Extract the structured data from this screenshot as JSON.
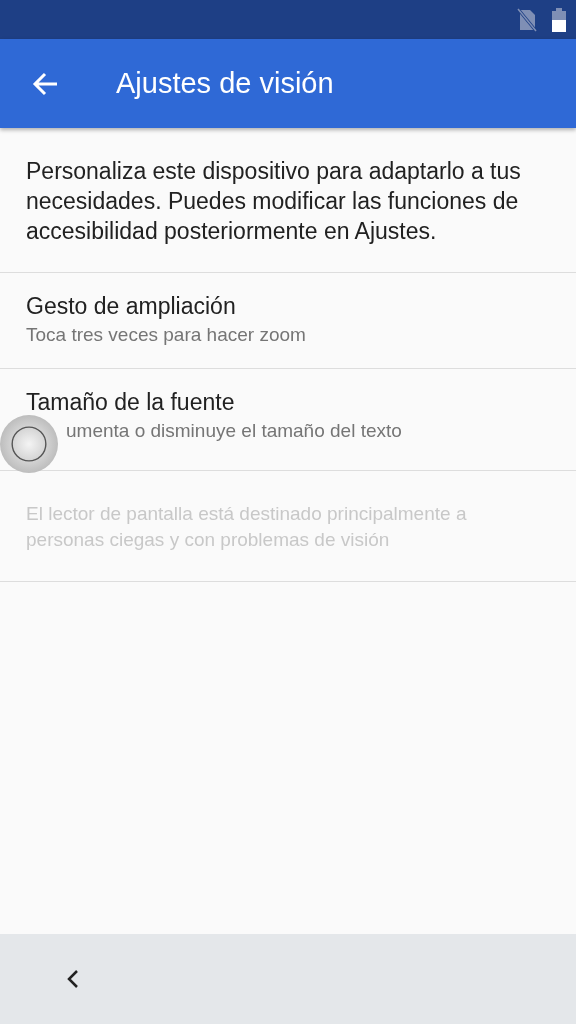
{
  "app_bar": {
    "title": "Ajustes de visión"
  },
  "intro": "Personaliza este dispositivo para adaptarlo a tus necesidades. Puedes modificar las funciones de accesibilidad posteriormente en Ajustes.",
  "items": [
    {
      "kind": "setting",
      "title": "Gesto de ampliación",
      "summary": "Toca tres veces para hacer zoom",
      "touch_indicator": false
    },
    {
      "kind": "setting",
      "title": "Tamaño de la fuente",
      "summary": "umenta o disminuye el tamaño del texto",
      "touch_indicator": true
    },
    {
      "kind": "note",
      "summary": "El lector de pantalla está destinado principalmente a personas ciegas y con problemas de visión",
      "disabled": true
    }
  ]
}
